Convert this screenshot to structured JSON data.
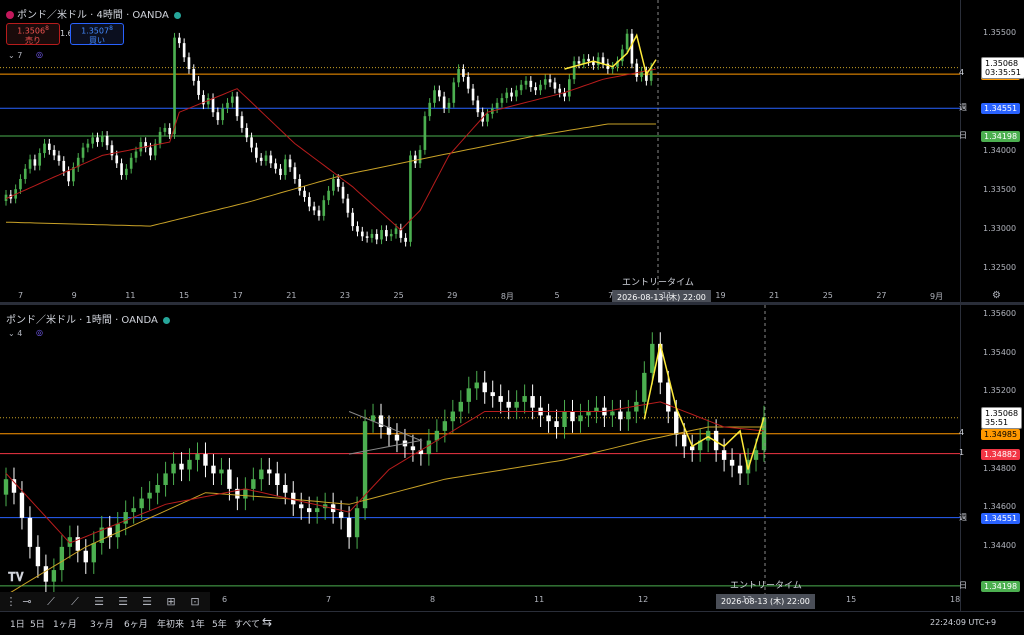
{
  "chart_data": [
    {
      "type": "candlestick",
      "title": "ポンド／米ドル · 4時間 · OANDA",
      "x_ticks": [
        "7",
        "9",
        "11",
        "15",
        "17",
        "21",
        "23",
        "25",
        "29",
        "8月",
        "5",
        "7",
        "11",
        "19",
        "21",
        "25",
        "27",
        "9月"
      ],
      "y_ticks": [
        "1.35500",
        "1.35000",
        "1.34500",
        "1.34000",
        "1.33500",
        "1.33000",
        "1.32500"
      ],
      "ylim": [
        1.323,
        1.357
      ],
      "last_price": "1.35068",
      "countdown": "03:35:51",
      "levels": [
        {
          "label": "4",
          "price": "1.34985",
          "color": "#ff9800"
        },
        {
          "label": "週",
          "price": "1.34551",
          "color": "#2962ff"
        },
        {
          "label": "日",
          "price": "1.34198",
          "color": "#4caf50"
        }
      ],
      "entry_label": "エントリータイム",
      "entry_date": "2026-08-13 (木)  22:00",
      "indicator_count": "7",
      "sell_price": "1.3506",
      "sell_sup": "8",
      "sell_label": "売り",
      "buy_price": "1.3507",
      "buy_sup": "8",
      "buy_label": "買い",
      "spread": "1.6",
      "closes": [
        1.3345,
        1.334,
        1.3352,
        1.3365,
        1.3378,
        1.339,
        1.3382,
        1.3398,
        1.341,
        1.3402,
        1.3395,
        1.3388,
        1.3375,
        1.3362,
        1.338,
        1.3392,
        1.3405,
        1.341,
        1.3418,
        1.3412,
        1.342,
        1.3408,
        1.3395,
        1.3385,
        1.337,
        1.3378,
        1.3392,
        1.34,
        1.3412,
        1.3405,
        1.3395,
        1.341,
        1.3425,
        1.343,
        1.3422,
        1.3545,
        1.3538,
        1.352,
        1.3505,
        1.349,
        1.3472,
        1.346,
        1.3468,
        1.345,
        1.344,
        1.3455,
        1.3462,
        1.347,
        1.3445,
        1.343,
        1.3418,
        1.3405,
        1.3392,
        1.3388,
        1.3395,
        1.3385,
        1.3378,
        1.337,
        1.339,
        1.338,
        1.3365,
        1.335,
        1.3342,
        1.333,
        1.3325,
        1.3318,
        1.3338,
        1.335,
        1.3365,
        1.3355,
        1.334,
        1.3322,
        1.3305,
        1.3298,
        1.3292,
        1.329,
        1.3295,
        1.3288,
        1.33,
        1.3292,
        1.3295,
        1.3302,
        1.329,
        1.3285,
        1.3395,
        1.3385,
        1.3402,
        1.3445,
        1.3462,
        1.3478,
        1.347,
        1.3455,
        1.3462,
        1.3488,
        1.3505,
        1.3495,
        1.348,
        1.3465,
        1.345,
        1.3438,
        1.3448,
        1.3455,
        1.3462,
        1.3468,
        1.3475,
        1.347,
        1.3478,
        1.3485,
        1.349,
        1.3482,
        1.3478,
        1.3485,
        1.3492,
        1.3488,
        1.348,
        1.3475,
        1.347,
        1.3492,
        1.3515,
        1.3512,
        1.3518,
        1.3515,
        1.351,
        1.352,
        1.3512,
        1.3505,
        1.3508,
        1.3515,
        1.353,
        1.355,
        1.3512,
        1.3495,
        1.3502,
        1.349,
        1.3507
      ],
      "ma_fast_anchor": [
        [
          0,
          1.334
        ],
        [
          20,
          1.3395
        ],
        [
          34,
          1.3412
        ],
        [
          36,
          1.345
        ],
        [
          48,
          1.348
        ],
        [
          60,
          1.341
        ],
        [
          72,
          1.3355
        ],
        [
          82,
          1.33
        ],
        [
          86,
          1.3325
        ],
        [
          92,
          1.3395
        ],
        [
          100,
          1.345
        ],
        [
          116,
          1.3475
        ],
        [
          124,
          1.3492
        ],
        [
          135,
          1.3505
        ]
      ],
      "ma_slow_anchor": [
        [
          0,
          1.331
        ],
        [
          30,
          1.3305
        ],
        [
          50,
          1.3335
        ],
        [
          70,
          1.337
        ],
        [
          90,
          1.3395
        ],
        [
          110,
          1.342
        ],
        [
          125,
          1.3435
        ],
        [
          135,
          1.3435
        ]
      ],
      "pattern_anchor": [
        [
          116,
          1.3505
        ],
        [
          122,
          1.3515
        ],
        [
          126,
          1.3508
        ],
        [
          129,
          1.3525
        ],
        [
          131,
          1.3548
        ],
        [
          133,
          1.3498
        ],
        [
          135,
          1.3517
        ]
      ]
    },
    {
      "type": "candlestick",
      "title": "ポンド／米ドル · 1時間 · OANDA",
      "x_ticks": [
        "6",
        "7",
        "8",
        "11",
        "12",
        "13",
        "15",
        "18"
      ],
      "y_ticks": [
        "1.35600",
        "1.35400",
        "1.35200",
        "1.35000",
        "1.34800",
        "1.34600",
        "1.34400"
      ],
      "ylim": [
        1.3412,
        1.3562
      ],
      "last_price": "1.35068",
      "countdown": "35:51",
      "levels": [
        {
          "label": "4",
          "price": "1.34985",
          "color": "#ff9800"
        },
        {
          "label": "1",
          "price": "1.34882",
          "color": "#f23645"
        },
        {
          "label": "週",
          "price": "1.34551",
          "color": "#2962ff"
        },
        {
          "label": "日",
          "price": "1.34198",
          "color": "#4caf50"
        }
      ],
      "entry_label": "エントリータイム",
      "entry_date": "2026-08-13 (木)  22:00",
      "indicator_count": "4",
      "closes": [
        1.3475,
        1.3468,
        1.3455,
        1.344,
        1.343,
        1.3422,
        1.3428,
        1.344,
        1.3445,
        1.3438,
        1.3432,
        1.3442,
        1.345,
        1.3445,
        1.3452,
        1.3458,
        1.346,
        1.3465,
        1.3468,
        1.3472,
        1.3478,
        1.3483,
        1.348,
        1.3485,
        1.3488,
        1.3482,
        1.3478,
        1.348,
        1.347,
        1.3465,
        1.347,
        1.3475,
        1.348,
        1.3478,
        1.3472,
        1.3468,
        1.3462,
        1.346,
        1.3458,
        1.346,
        1.3462,
        1.3458,
        1.3455,
        1.3445,
        1.346,
        1.3505,
        1.3508,
        1.3502,
        1.3498,
        1.3495,
        1.3492,
        1.349,
        1.3488,
        1.3495,
        1.35,
        1.3505,
        1.351,
        1.3515,
        1.3522,
        1.3525,
        1.352,
        1.3518,
        1.3515,
        1.3512,
        1.3515,
        1.3518,
        1.3512,
        1.3508,
        1.3505,
        1.3502,
        1.351,
        1.3505,
        1.3508,
        1.351,
        1.3512,
        1.3508,
        1.351,
        1.3506,
        1.351,
        1.3515,
        1.353,
        1.3545,
        1.3525,
        1.351,
        1.3498,
        1.3492,
        1.349,
        1.3495,
        1.35,
        1.349,
        1.3485,
        1.3482,
        1.3478,
        1.3485,
        1.349,
        1.3507
      ],
      "ma_fast_anchor": [
        [
          0,
          1.3478
        ],
        [
          8,
          1.3442
        ],
        [
          20,
          1.3462
        ],
        [
          30,
          1.347
        ],
        [
          43,
          1.3458
        ],
        [
          48,
          1.348
        ],
        [
          60,
          1.351
        ],
        [
          75,
          1.351
        ],
        [
          82,
          1.3515
        ],
        [
          90,
          1.3502
        ],
        [
          95,
          1.35
        ]
      ],
      "ma_slow_anchor": [
        [
          0,
          1.3415
        ],
        [
          10,
          1.344
        ],
        [
          25,
          1.3468
        ],
        [
          35,
          1.3465
        ],
        [
          43,
          1.3462
        ],
        [
          55,
          1.3475
        ],
        [
          70,
          1.3485
        ],
        [
          80,
          1.3495
        ],
        [
          88,
          1.3502
        ],
        [
          95,
          1.3502
        ]
      ],
      "pattern_anchor": [
        [
          80,
          1.3506
        ],
        [
          82,
          1.3545
        ],
        [
          84,
          1.3512
        ],
        [
          86,
          1.3492
        ],
        [
          88,
          1.3497
        ],
        [
          90,
          1.3492
        ],
        [
          92,
          1.35
        ],
        [
          93,
          1.348
        ],
        [
          95,
          1.3507
        ]
      ],
      "wedge_anchor": [
        [
          43,
          1.351
        ],
        [
          52,
          1.3495
        ],
        [
          43,
          1.3488
        ]
      ]
    }
  ],
  "bottom": {
    "timeframes": [
      "1日",
      "5日",
      "1ヶ月",
      "3ヶ月",
      "6ヶ月",
      "年初来",
      "1年",
      "5年",
      "すべて"
    ],
    "clock": "22:24:09 UTC+9"
  },
  "colors": {
    "up": "#26a69a",
    "down": "#ffffff",
    "up_fill": "#4caf50",
    "ma_fast": "#b71c1c",
    "ma_slow": "#c9a227",
    "pattern": "#ffeb3b"
  }
}
